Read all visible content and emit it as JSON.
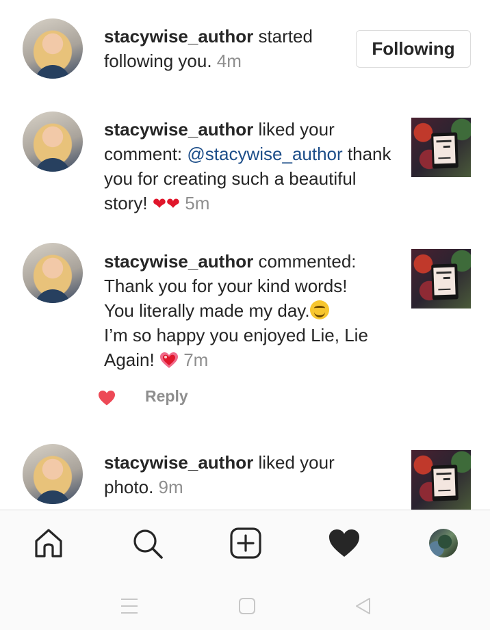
{
  "notifications": [
    {
      "username": "stacywise_author",
      "action": "started following you.",
      "time": "4m",
      "button_label": "Following"
    },
    {
      "username": "stacywise_author",
      "action": "liked your comment:",
      "mention": "@stacywise_author",
      "comment": "thank you for creating such a beautiful story!",
      "emoji": "❤❤",
      "time": "5m"
    },
    {
      "username": "stacywise_author",
      "action": "commented:",
      "comment_line1": "Thank you for your kind words!",
      "comment_line2": "You literally made my day.",
      "comment_line3": "I’m so happy you enjoyed Lie, Lie",
      "comment_line4": "Again!",
      "time": "7m",
      "reply_label": "Reply"
    },
    {
      "username": "stacywise_author",
      "action": "liked your photo.",
      "time": "9m"
    }
  ],
  "tabbar": {
    "items": [
      "home-icon",
      "search-icon",
      "new-post-icon",
      "activity-heart-icon",
      "profile-avatar"
    ]
  },
  "system_nav": {
    "items": [
      "menu-icon",
      "home-square-icon",
      "back-triangle-icon"
    ]
  },
  "colors": {
    "text": "#262626",
    "muted": "#8e8e8e",
    "mention": "#1d4e89",
    "like": "#ed4956"
  }
}
